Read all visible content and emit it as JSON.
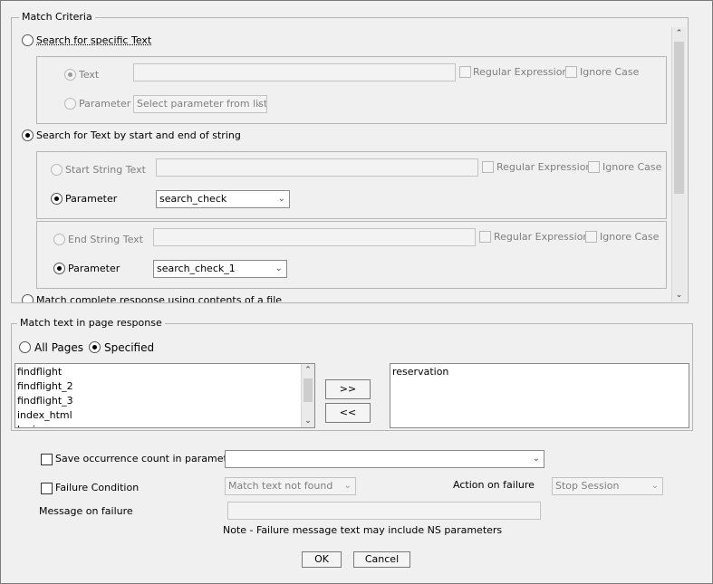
{
  "match_criteria": {
    "legend": "Match Criteria",
    "specific_text": {
      "label": "Search for specific Text",
      "selected": false,
      "text_option": {
        "label": "Text",
        "selected": true
      },
      "text_value": "",
      "regex_label": "Regular Expression",
      "ignore_case_label": "Ignore Case",
      "param_option": {
        "label": "Parameter",
        "selected": false
      },
      "param_select": "Select parameter from list"
    },
    "start_end": {
      "label": "Search for Text by start and end of string",
      "selected": true,
      "start": {
        "text_label": "Start String Text",
        "text_value": "",
        "regex_label": "Regular Expression",
        "ignore_case_label": "Ignore Case",
        "param_label": "Parameter",
        "param_value": "search_check"
      },
      "end": {
        "text_label": "End String Text",
        "text_value": "",
        "regex_label": "Regular Expression",
        "ignore_case_label": "Ignore Case",
        "param_label": "Parameter",
        "param_value": "search_check_1"
      }
    },
    "complete_response": {
      "label": "Match complete response using contents of a file",
      "selected": false
    }
  },
  "match_page": {
    "legend": "Match text in page response",
    "all_pages_label": "All Pages",
    "specified_label": "Specified",
    "selected": "Specified",
    "available_pages": [
      "findflight",
      "findflight_2",
      "findflight_3",
      "index_html",
      "login"
    ],
    "selected_pages": [
      "reservation"
    ],
    "add_button": ">>",
    "remove_button": "<<"
  },
  "options": {
    "save_count_label": "Save occurrence count in parameter",
    "save_count_value": "",
    "failure_condition_label": "Failure Condition",
    "failure_condition_value": "Match text not found",
    "action_on_failure_label": "Action on failure",
    "action_on_failure_value": "Stop Session",
    "message_label": "Message on failure",
    "message_value": "",
    "note": "Note - Failure message text may include NS parameters"
  },
  "buttons": {
    "ok": "OK",
    "cancel": "Cancel"
  }
}
